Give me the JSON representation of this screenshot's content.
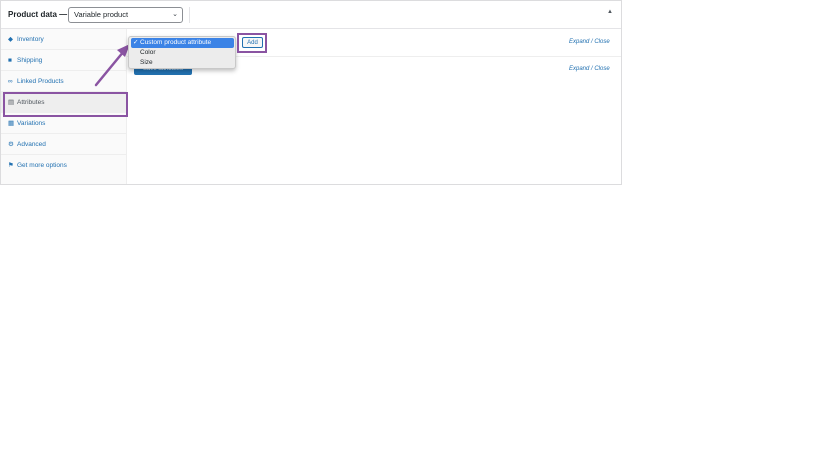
{
  "header": {
    "title": "Product data —",
    "product_type": "Variable product",
    "collapse_icon": "caret-up-icon"
  },
  "sidebar": {
    "items": [
      {
        "label": "Inventory",
        "icon": "diamond-icon"
      },
      {
        "label": "Shipping",
        "icon": "truck-icon"
      },
      {
        "label": "Linked Products",
        "icon": "link-icon"
      },
      {
        "label": "Attributes",
        "icon": "table-icon",
        "active": true
      },
      {
        "label": "Variations",
        "icon": "grid-icon"
      },
      {
        "label": "Advanced",
        "icon": "gear-icon"
      },
      {
        "label": "Get more options",
        "icon": "plugin-icon"
      }
    ]
  },
  "attributes": {
    "dropdown_options": [
      "Custom product attribute",
      "Color",
      "Size"
    ],
    "selected_option": "Custom product attribute",
    "add_label": "Add",
    "expand_close_label": "Expand / Close",
    "save_label": "Save attributes"
  },
  "annotations": {
    "highlight_color": "#8a54a2"
  },
  "colors": {
    "link": "#2271b1",
    "selected": "#3b83e6"
  }
}
